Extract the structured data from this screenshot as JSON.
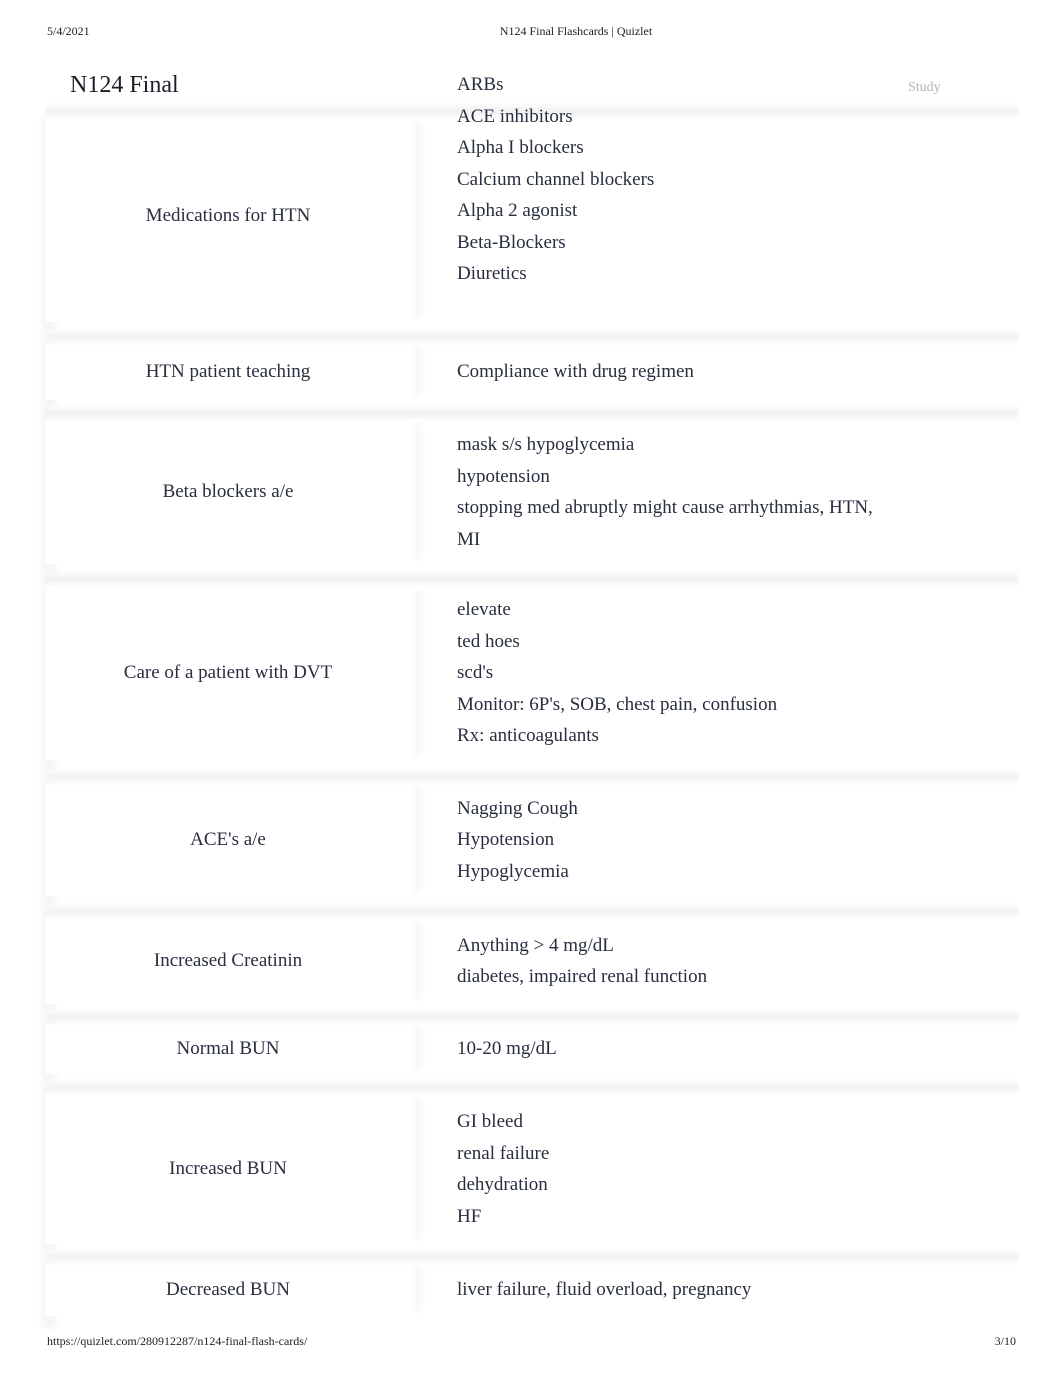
{
  "print_header": {
    "date": "5/4/2021",
    "title": "N124 Final Flashcards | Quizlet"
  },
  "print_footer": {
    "url": "https://quizlet.com/280912287/n124-final-flash-cards/",
    "page": "3/10"
  },
  "set": {
    "title": "N124 Final",
    "study_label": "Study"
  },
  "cards": [
    {
      "term": "Medications for HTN",
      "definition": [
        "ARBs",
        "ACE inhibitors",
        "Alpha I blockers",
        "Calcium channel blockers",
        "Alpha 2 agonist",
        "Beta-Blockers",
        "Diuretics"
      ]
    },
    {
      "term": "HTN patient teaching",
      "definition": [
        "Compliance with drug regimen"
      ]
    },
    {
      "term": "Beta blockers a/e",
      "definition": [
        "mask s/s hypoglycemia",
        "hypotension",
        "stopping med abruptly might cause arrhythmias, HTN,",
        "MI"
      ]
    },
    {
      "term": "Care of a patient with DVT",
      "definition": [
        "elevate",
        "ted hoes",
        "scd's",
        "Monitor: 6P's, SOB, chest pain, confusion",
        "Rx: anticoagulants"
      ]
    },
    {
      "term": "ACE's a/e",
      "definition": [
        "Nagging Cough",
        "Hypotension",
        "Hypoglycemia"
      ]
    },
    {
      "term": "Increased Creatinin",
      "definition": [
        "Anything > 4 mg/dL",
        "diabetes, impaired renal function"
      ]
    },
    {
      "term": "Normal BUN",
      "definition": [
        "10-20 mg/dL"
      ]
    },
    {
      "term": "Increased BUN",
      "definition": [
        "GI bleed",
        "renal failure",
        "dehydration",
        "HF"
      ]
    },
    {
      "term": "Decreased BUN",
      "definition": [
        "liver failure, fluid overload, pregnancy"
      ]
    }
  ]
}
